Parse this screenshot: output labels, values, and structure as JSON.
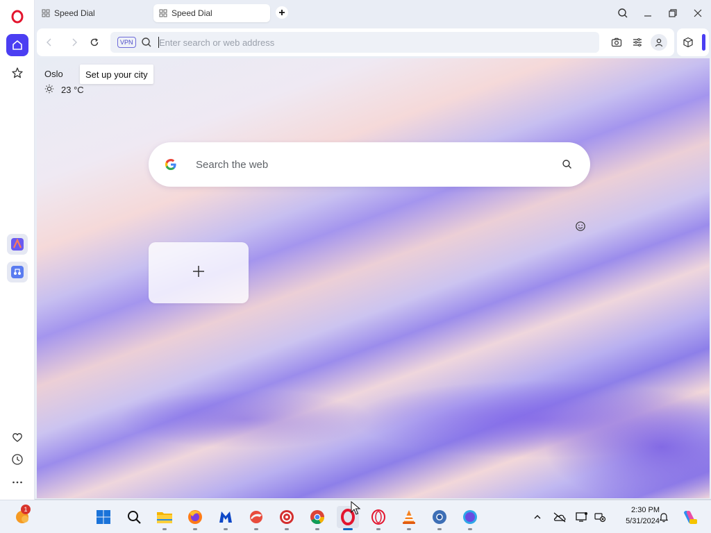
{
  "browser": {
    "tabs": [
      {
        "label": "Speed Dial",
        "active": false
      },
      {
        "label": "Speed Dial",
        "active": true
      }
    ],
    "address_bar": {
      "vpn_label": "VPN",
      "placeholder": "Enter search or web address",
      "value": ""
    }
  },
  "sidebar": {
    "items": [
      {
        "name": "opera-logo-icon"
      },
      {
        "name": "home-icon",
        "active": true
      },
      {
        "name": "star-icon"
      },
      {
        "name": "aria-icon"
      },
      {
        "name": "music-player-icon"
      },
      {
        "name": "heart-icon"
      },
      {
        "name": "history-icon"
      },
      {
        "name": "more-icon"
      }
    ]
  },
  "weather": {
    "city": "Oslo",
    "setup_label": "Set up your city",
    "temperature": "23 °C",
    "condition_icon": "sun-icon"
  },
  "search": {
    "placeholder": "Search the web",
    "engine_icon": "google-icon"
  },
  "speed_dial": {
    "add_icon": "plus-icon"
  },
  "taskbar": {
    "notification_badge": "1",
    "clock_time": "2:30 PM",
    "clock_date": "5/31/2024",
    "apps": [
      "start-icon",
      "search-icon",
      "file-explorer-icon",
      "firefox-icon",
      "malwarebytes-icon",
      "ccleaner-icon",
      "app-red-icon",
      "chrome-icon",
      "opera-icon",
      "opera-gx-icon",
      "vlc-icon",
      "chromium-icon",
      "edge-blue-icon"
    ]
  },
  "colors": {
    "accent": "#4b3ef2",
    "opera_red": "#e3152e"
  }
}
